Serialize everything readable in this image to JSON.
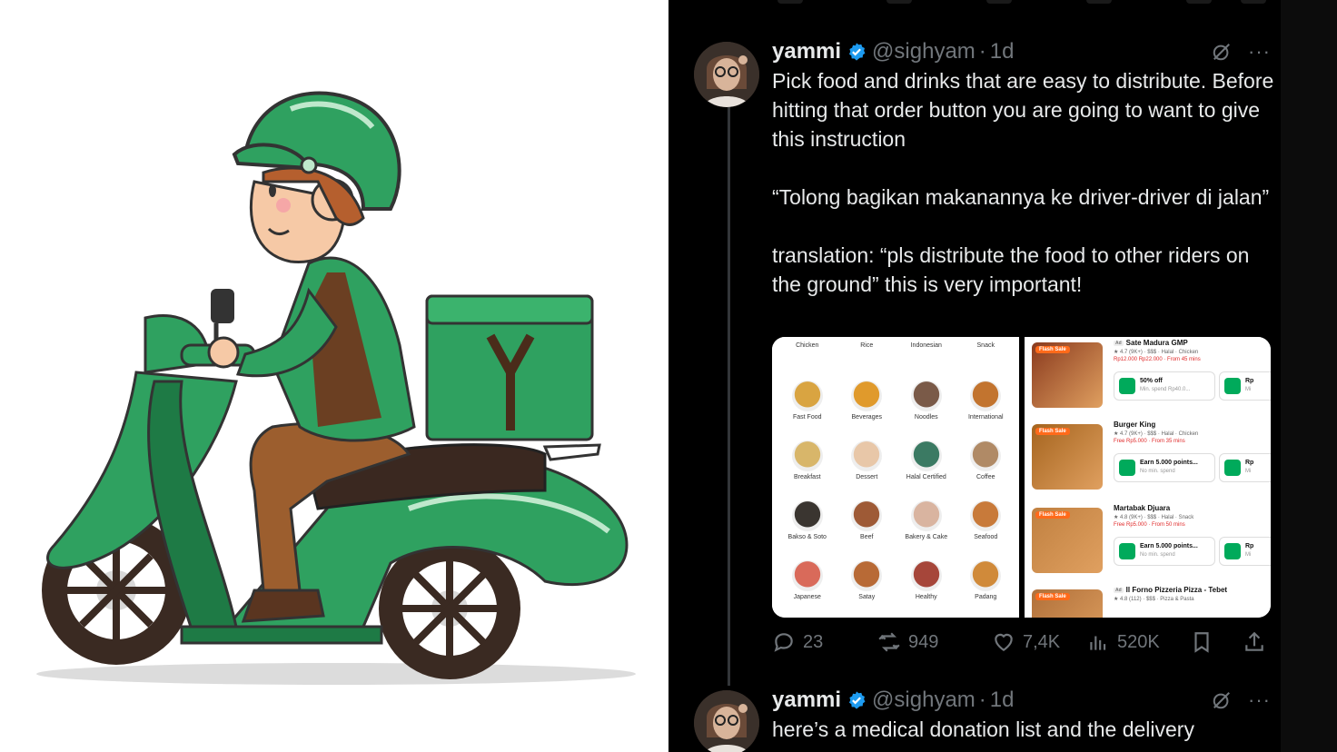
{
  "tweets": [
    {
      "name": "yammi",
      "handle": "@sighyam",
      "dot": "·",
      "time": "1d",
      "more": "···",
      "text": "Pick food and drinks that are easy to distribute. Before hitting that order button you are going to want to give this instruction\n\n“Tolong bagikan makanannya ke driver-driver di jalan”\n\ntranslation: “pls distribute the food to other riders on the ground” this is very important!"
    },
    {
      "name": "yammi",
      "handle": "@sighyam",
      "dot": "·",
      "time": "1d",
      "more": "···",
      "text": "here’s a medical donation list and the delivery"
    }
  ],
  "media": {
    "categories": [
      {
        "label": "Chicken",
        "color": "#c98a4a"
      },
      {
        "label": "Rice",
        "color": "#e8d8b0"
      },
      {
        "label": "Indonesian",
        "color": "#b5663a"
      },
      {
        "label": "Snack",
        "color": "#2e9e5a"
      },
      {
        "label": "Fast Food",
        "color": "#d9a441"
      },
      {
        "label": "Beverages",
        "color": "#e09a2c"
      },
      {
        "label": "Noodles",
        "color": "#7a5a48"
      },
      {
        "label": "International",
        "color": "#c2742f"
      },
      {
        "label": "Breakfast",
        "color": "#d8b66a"
      },
      {
        "label": "Dessert",
        "color": "#e8c7a8"
      },
      {
        "label": "Halal Certified",
        "color": "#3b7a63"
      },
      {
        "label": "Coffee",
        "color": "#b08a66"
      },
      {
        "label": "Bakso & Soto",
        "color": "#3a3530"
      },
      {
        "label": "Beef",
        "color": "#9e5a36"
      },
      {
        "label": "Bakery & Cake",
        "color": "#d9b4a0"
      },
      {
        "label": "Seafood",
        "color": "#c87a3a"
      },
      {
        "label": "Japanese",
        "color": "#d96a5a"
      },
      {
        "label": "Satay",
        "color": "#b86a36"
      },
      {
        "label": "Healthy",
        "color": "#a6463a"
      },
      {
        "label": "Padang",
        "color": "#d08a3a"
      }
    ],
    "restaurants": [
      {
        "name": "Sate Madura GMP",
        "ad": "Ad",
        "meta": "★ 4.7 (9K+) · $$$ · Halal · Chicken",
        "meta2": "Rp12.000 Rp22.000 · From 45 mins",
        "promo_title": "50% off",
        "promo_sub": "Min. spend Rp40.0...",
        "promo2_title": "Rp",
        "promo2_sub": "Mi",
        "thumb": "#8a3a1e",
        "flash": "Flash Sale"
      },
      {
        "name": "Burger King",
        "ad": "",
        "meta": "★ 4.7 (9K+) · $$$ · Halal · Chicken",
        "meta2": "Free Rp5.000 · From 35 mins",
        "promo_title": "Earn 5.000 points...",
        "promo_sub": "No min. spend",
        "promo2_title": "Rp",
        "promo2_sub": "Mi",
        "thumb": "#a5641e",
        "flash": "Flash Sale"
      },
      {
        "name": "Martabak Djuara",
        "ad": "",
        "meta": "★ 4.8 (9K+) · $$$ · Halal · Snack",
        "meta2": "Free Rp5.000 · From 50 mins",
        "promo_title": "Earn 5.000 points...",
        "promo_sub": "No min. spend",
        "promo2_title": "Rp",
        "promo2_sub": "Mi",
        "thumb": "#c08040",
        "flash": "Flash Sale"
      },
      {
        "name": "Il Forno Pizzeria Pizza - Tebet",
        "ad": "Ad",
        "meta": "★ 4.8 (112) · $$$ · Pizza & Pasta",
        "meta2": "",
        "promo_title": "",
        "promo_sub": "",
        "promo2_title": "",
        "promo2_sub": "",
        "thumb": "#b0703a",
        "flash": "Flash Sale"
      }
    ]
  },
  "actions": {
    "replies": "23",
    "reposts": "949",
    "likes": "7,4K",
    "views": "520K"
  },
  "colors": {
    "brand_green": "#2fa160",
    "dark_green": "#1e7a45",
    "brown": "#6b3f22",
    "verified_blue": "#1d9bf0",
    "muted": "#71767b"
  }
}
